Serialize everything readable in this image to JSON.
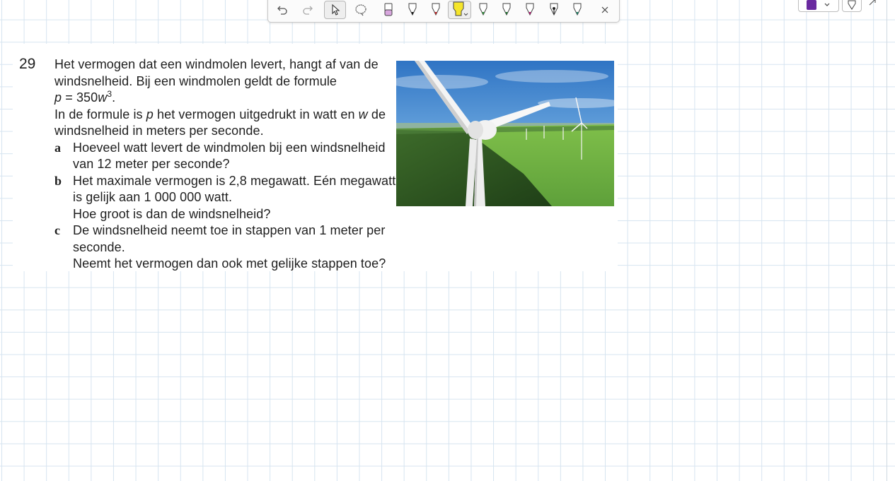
{
  "question": {
    "number": "29",
    "intro": [
      "Het vermogen dat een windmolen levert, hangt af van de",
      "windsnelheid. Bij een windmolen geldt de formule"
    ],
    "formula": {
      "lhs": "p",
      "eq": " = 350",
      "var": "w",
      "exp": "3",
      "end": "."
    },
    "def_line1": {
      "a": "In de formule is ",
      "p": "p",
      "b": " het vermogen uitgedrukt in watt en ",
      "w": "w",
      "c": " de"
    },
    "def_line2": "windsnelheid in meters per seconde.",
    "parts": [
      {
        "label": "a",
        "lines": [
          "Hoeveel watt levert de windmolen bij een windsnelheid",
          "van 12 meter per seconde?"
        ]
      },
      {
        "label": "b",
        "lines": [
          "Het maximale vermogen is 2,8 megawatt. Eén megawatt",
          "is gelijk aan 1 000 000 watt.",
          "Hoe groot is dan de windsnelheid?"
        ]
      },
      {
        "label": "c",
        "lines": [
          "De windsnelheid neemt toe in stappen van 1 meter per",
          "seconde.",
          "Neemt het vermogen dan ook met gelijke stappen toe?"
        ]
      }
    ]
  },
  "toolbar": {
    "tools": [
      "undo-icon",
      "redo-icon",
      "select-icon",
      "lasso-icon",
      "eraser-icon",
      "pen-black-icon",
      "pen-red-icon",
      "highlighter-yellow-icon",
      "pen-green-icon",
      "pen-darkgreen-icon",
      "pen-magenta-icon",
      "pen-black-fountain-icon",
      "pen-teal-icon",
      "close-icon"
    ],
    "selected": [
      "select-icon",
      "highlighter-yellow-icon"
    ]
  },
  "colors": {
    "ink_color_swatch": "#6a2aa0",
    "highlighter": "#f5e52a",
    "grid": "#d6e4f0"
  }
}
